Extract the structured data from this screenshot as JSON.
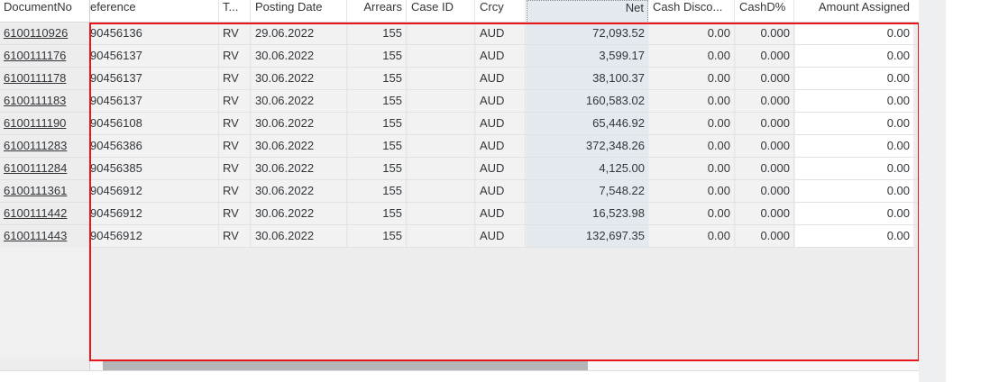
{
  "columns": {
    "documentno": "DocumentNo",
    "reference": "eference",
    "type": "T...",
    "posting_date": "Posting Date",
    "arrears": "Arrears",
    "case_id": "Case ID",
    "crcy": "Crcy",
    "net": "Net",
    "cash_discount": "Cash Disco...",
    "cashd_pct": "CashD%",
    "amount_assigned": "Amount Assigned"
  },
  "rows": [
    {
      "doc": "6100110926",
      "ref": "90456136",
      "type": "RV",
      "date": "29.06.2022",
      "arrears": "155",
      "case": "",
      "crcy": "AUD",
      "net": "72,093.52",
      "cd": "0.00",
      "cdp": "0.000",
      "amt": "0.00"
    },
    {
      "doc": "6100111176",
      "ref": "90456137",
      "type": "RV",
      "date": "30.06.2022",
      "arrears": "155",
      "case": "",
      "crcy": "AUD",
      "net": "3,599.17",
      "cd": "0.00",
      "cdp": "0.000",
      "amt": "0.00"
    },
    {
      "doc": "6100111178",
      "ref": "90456137",
      "type": "RV",
      "date": "30.06.2022",
      "arrears": "155",
      "case": "",
      "crcy": "AUD",
      "net": "38,100.37",
      "cd": "0.00",
      "cdp": "0.000",
      "amt": "0.00"
    },
    {
      "doc": "6100111183",
      "ref": "90456137",
      "type": "RV",
      "date": "30.06.2022",
      "arrears": "155",
      "case": "",
      "crcy": "AUD",
      "net": "160,583.02",
      "cd": "0.00",
      "cdp": "0.000",
      "amt": "0.00"
    },
    {
      "doc": "6100111190",
      "ref": "90456108",
      "type": "RV",
      "date": "30.06.2022",
      "arrears": "155",
      "case": "",
      "crcy": "AUD",
      "net": "65,446.92",
      "cd": "0.00",
      "cdp": "0.000",
      "amt": "0.00"
    },
    {
      "doc": "6100111283",
      "ref": "90456386",
      "type": "RV",
      "date": "30.06.2022",
      "arrears": "155",
      "case": "",
      "crcy": "AUD",
      "net": "372,348.26",
      "cd": "0.00",
      "cdp": "0.000",
      "amt": "0.00"
    },
    {
      "doc": "6100111284",
      "ref": "90456385",
      "type": "RV",
      "date": "30.06.2022",
      "arrears": "155",
      "case": "",
      "crcy": "AUD",
      "net": "4,125.00",
      "cd": "0.00",
      "cdp": "0.000",
      "amt": "0.00"
    },
    {
      "doc": "6100111361",
      "ref": "90456912",
      "type": "RV",
      "date": "30.06.2022",
      "arrears": "155",
      "case": "",
      "crcy": "AUD",
      "net": "7,548.22",
      "cd": "0.00",
      "cdp": "0.000",
      "amt": "0.00"
    },
    {
      "doc": "6100111442",
      "ref": "90456912",
      "type": "RV",
      "date": "30.06.2022",
      "arrears": "155",
      "case": "",
      "crcy": "AUD",
      "net": "16,523.98",
      "cd": "0.00",
      "cdp": "0.000",
      "amt": "0.00"
    },
    {
      "doc": "6100111443",
      "ref": "90456912",
      "type": "RV",
      "date": "30.06.2022",
      "arrears": "155",
      "case": "",
      "crcy": "AUD",
      "net": "132,697.35",
      "cd": "0.00",
      "cdp": "0.000",
      "amt": "0.00"
    }
  ],
  "colors": {
    "selection_border": "#e8161a",
    "net_column_bg": "#e3e9ef",
    "scroll_thumb": "#b3b5b8"
  }
}
